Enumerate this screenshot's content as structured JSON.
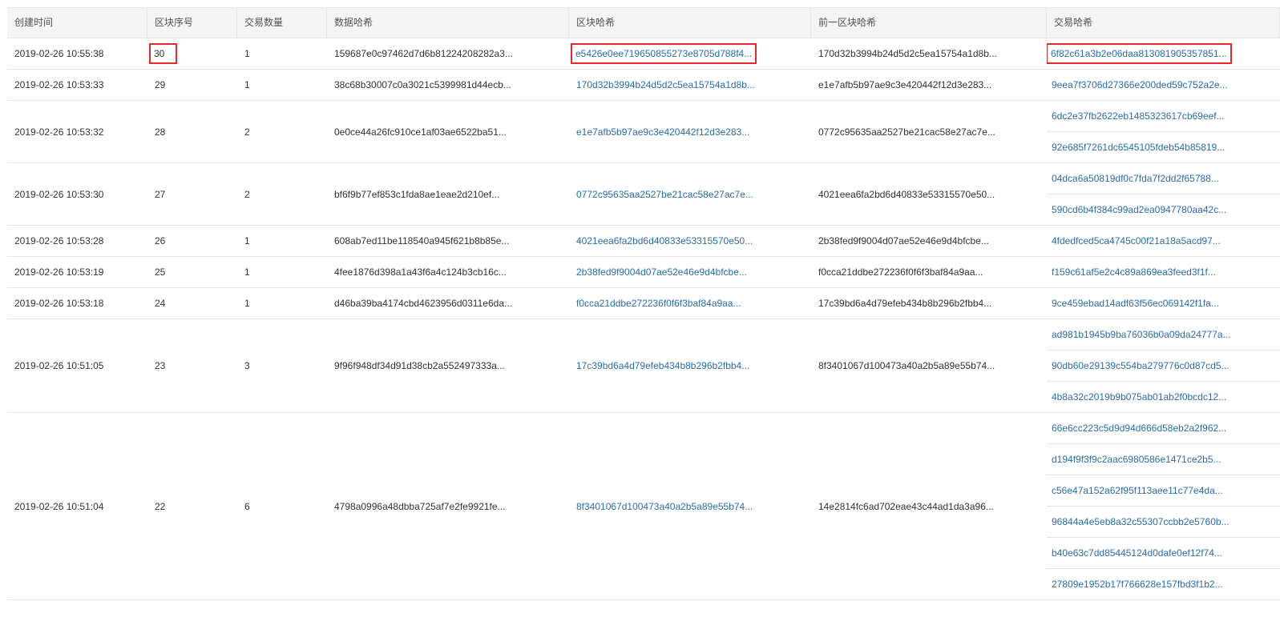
{
  "table": {
    "columns": [
      "创建时间",
      "区块序号",
      "交易数量",
      "数据哈希",
      "区块哈希",
      "前一区块哈希",
      "交易哈希"
    ],
    "rows": [
      {
        "time": "2019-02-26 10:55:38",
        "number": "30",
        "tx_count": "1",
        "data_hash": "159687e0c97462d7d6b81224208282a3...",
        "block_hash": "e5426e0ee719650855273e8705d788f4...",
        "prev_hash": "170d32b3994b24d5d2c5ea15754a1d8b...",
        "tx_hashes": [
          "6f82c61a3b2e06daa813081905357851..."
        ]
      },
      {
        "time": "2019-02-26 10:53:33",
        "number": "29",
        "tx_count": "1",
        "data_hash": "38c68b30007c0a3021c5399981d44ecb...",
        "block_hash": "170d32b3994b24d5d2c5ea15754a1d8b...",
        "prev_hash": "e1e7afb5b97ae9c3e420442f12d3e283...",
        "tx_hashes": [
          "9eea7f3706d27366e200ded59c752a2e..."
        ]
      },
      {
        "time": "2019-02-26 10:53:32",
        "number": "28",
        "tx_count": "2",
        "data_hash": "0e0ce44a26fc910ce1af03ae6522ba51...",
        "block_hash": "e1e7afb5b97ae9c3e420442f12d3e283...",
        "prev_hash": "0772c95635aa2527be21cac58e27ac7e...",
        "tx_hashes": [
          "6dc2e37fb2622eb1485323617cb69eef...",
          "92e685f7261dc6545105fdeb54b85819..."
        ]
      },
      {
        "time": "2019-02-26 10:53:30",
        "number": "27",
        "tx_count": "2",
        "data_hash": "bf6f9b77ef853c1fda8ae1eae2d210ef...",
        "block_hash": "0772c95635aa2527be21cac58e27ac7e...",
        "prev_hash": "4021eea6fa2bd6d40833e53315570e50...",
        "tx_hashes": [
          "04dca6a50819df0c7fda7f2dd2f65788...",
          "590cd6b4f384c99ad2ea0947780aa42c..."
        ]
      },
      {
        "time": "2019-02-26 10:53:28",
        "number": "26",
        "tx_count": "1",
        "data_hash": "608ab7ed11be118540a945f621b8b85e...",
        "block_hash": "4021eea6fa2bd6d40833e53315570e50...",
        "prev_hash": "2b38fed9f9004d07ae52e46e9d4bfcbe...",
        "tx_hashes": [
          "4fdedfced5ca4745c00f21a18a5acd97..."
        ]
      },
      {
        "time": "2019-02-26 10:53:19",
        "number": "25",
        "tx_count": "1",
        "data_hash": "4fee1876d398a1a43f6a4c124b3cb16c...",
        "block_hash": "2b38fed9f9004d07ae52e46e9d4bfcbe...",
        "prev_hash": "f0cca21ddbe272236f0f6f3baf84a9aa...",
        "tx_hashes": [
          "f159c61af5e2c4c89a869ea3feed3f1f..."
        ]
      },
      {
        "time": "2019-02-26 10:53:18",
        "number": "24",
        "tx_count": "1",
        "data_hash": "d46ba39ba4174cbd4623956d0311e6da...",
        "block_hash": "f0cca21ddbe272236f0f6f3baf84a9aa...",
        "prev_hash": "17c39bd6a4d79efeb434b8b296b2fbb4...",
        "tx_hashes": [
          "9ce459ebad14adf63f56ec069142f1fa..."
        ]
      },
      {
        "time": "2019-02-26 10:51:05",
        "number": "23",
        "tx_count": "3",
        "data_hash": "9f96f948df34d91d38cb2a552497333a...",
        "block_hash": "17c39bd6a4d79efeb434b8b296b2fbb4...",
        "prev_hash": "8f3401067d100473a40a2b5a89e55b74...",
        "tx_hashes": [
          "ad981b1945b9ba76036b0a09da24777a...",
          "90db60e29139c554ba279776c0d87cd5...",
          "4b8a32c2019b9b075ab01ab2f0bcdc12..."
        ]
      },
      {
        "time": "2019-02-26 10:51:04",
        "number": "22",
        "tx_count": "6",
        "data_hash": "4798a0996a48dbba725af7e2fe9921fe...",
        "block_hash": "8f3401067d100473a40a2b5a89e55b74...",
        "prev_hash": "14e2814fc6ad702eae43c44ad1da3a96...",
        "tx_hashes": [
          "66e6cc223c5d9d94d666d58eb2a2f962...",
          "d194f9f3f9c2aac6980586e1471ce2b5...",
          "c56e47a152a62f95f113aee11c77e4da...",
          "96844a4e5eb8a32c55307ccbb2e5760b...",
          "b40e63c7dd85445124d0dafe0ef12f74...",
          "27809e1952b17f766628e157fbd3f1b2..."
        ]
      }
    ]
  },
  "colors": {
    "link": "#2a6dac",
    "highlight": "#e8282b",
    "header_bg": "#f4f4f4",
    "border": "#e6e6e6"
  }
}
